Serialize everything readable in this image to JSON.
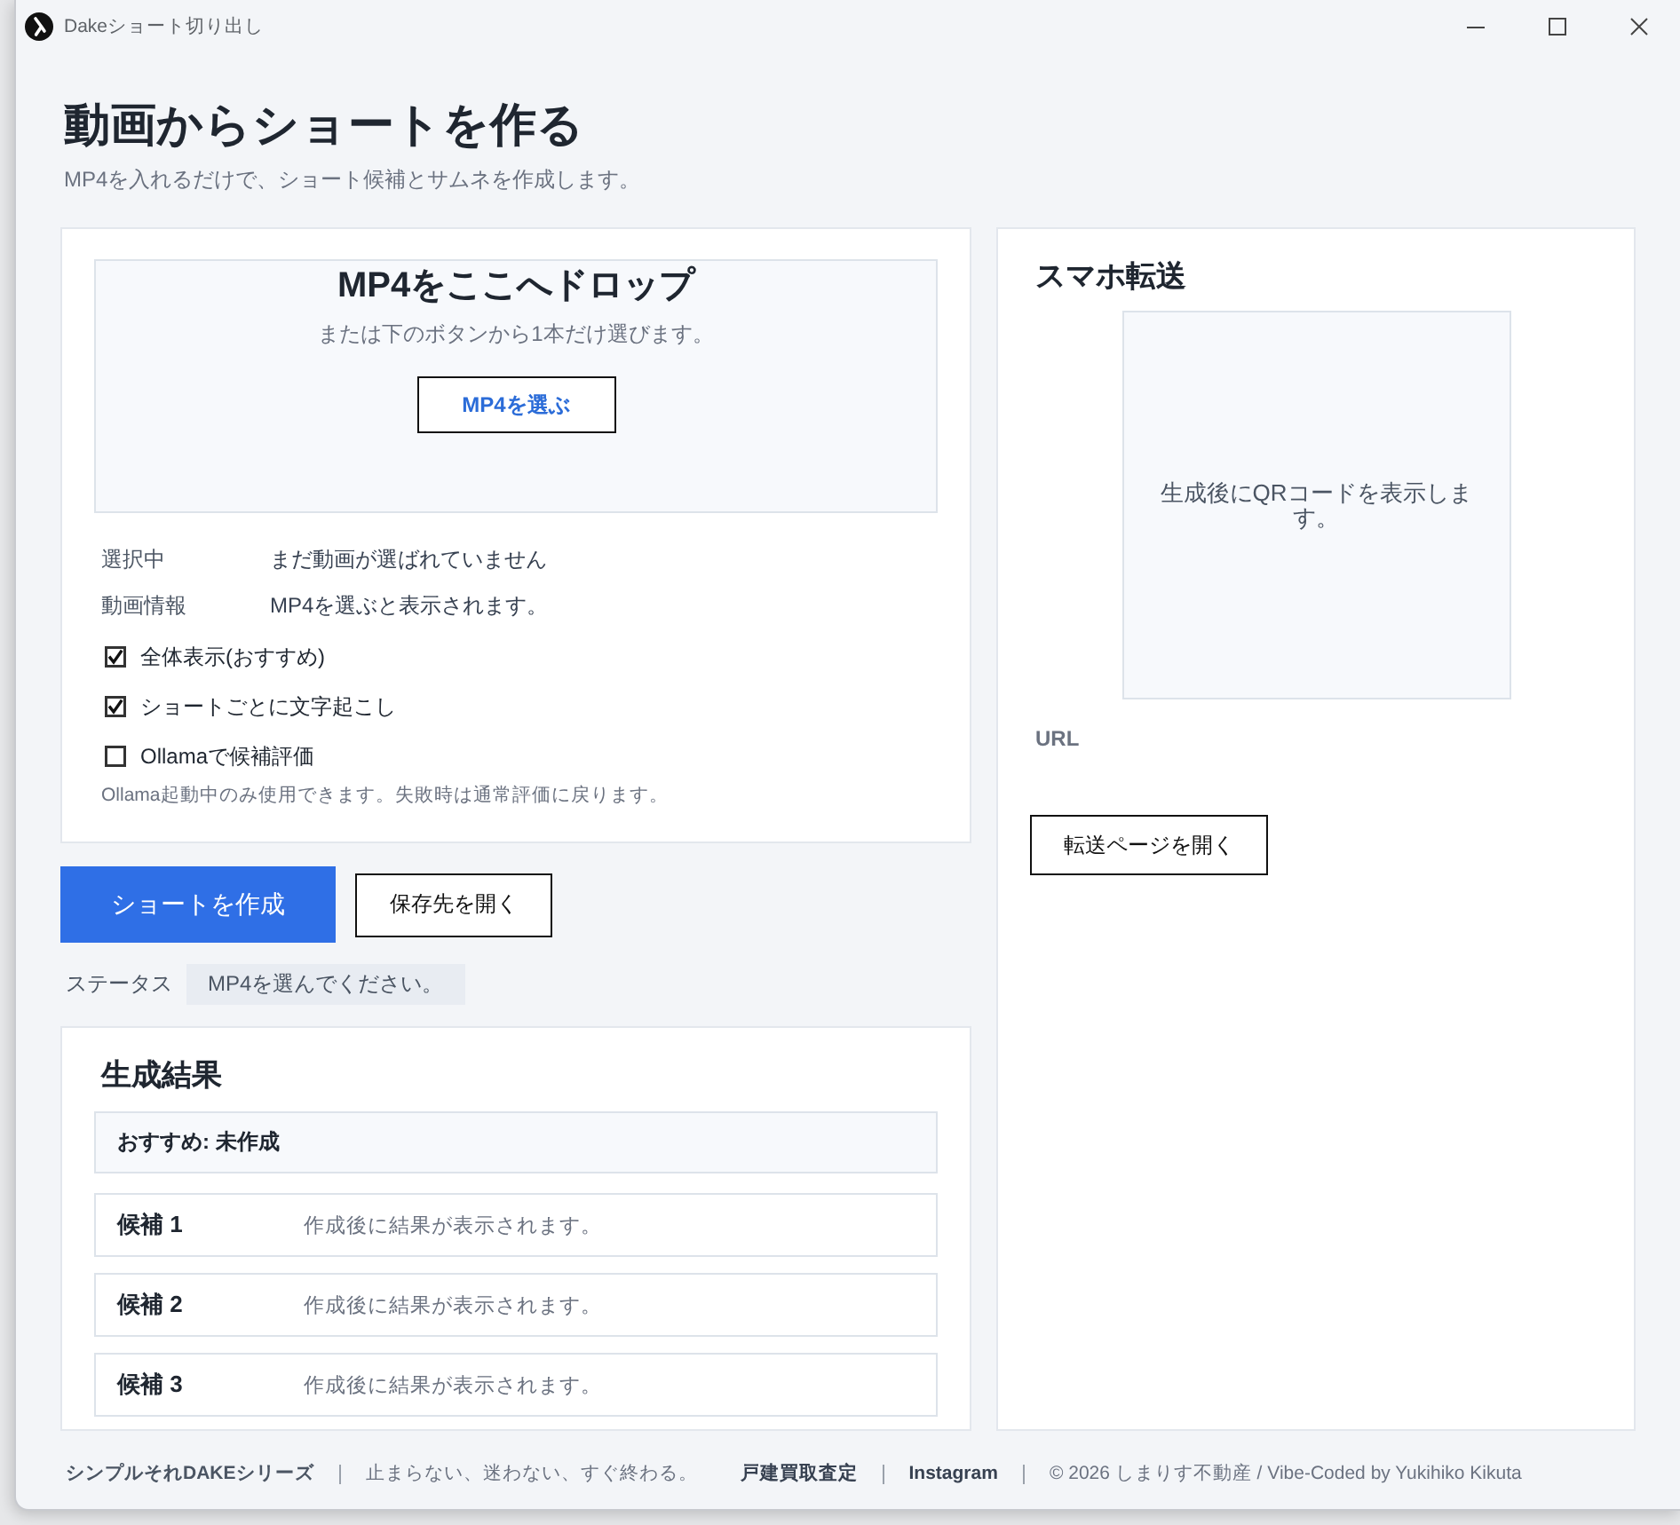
{
  "window": {
    "title": "Dakeショート切り出し"
  },
  "header": {
    "title": "動画からショートを作る",
    "subtitle": "MP4を入れるだけで、ショート候補とサムネを作成します。"
  },
  "input_card": {
    "drop_zone": {
      "title": "MP4をここへドロップ",
      "hint": "または下のボタンから1本だけ選びます。",
      "button": "MP4を選ぶ"
    },
    "info": [
      {
        "label": "選択中",
        "value": "まだ動画が選ばれていません"
      },
      {
        "label": "動画情報",
        "value": "MP4を選ぶと表示されます。"
      }
    ],
    "options": [
      {
        "label": "全体表示(おすすめ)",
        "checked": true
      },
      {
        "label": "ショートごとに文字起こし",
        "checked": true
      },
      {
        "label": "Ollamaで候補評価",
        "checked": false
      }
    ],
    "note": "Ollama起動中のみ使用できます。失敗時は通常評価に戻ります。"
  },
  "actions": [
    {
      "kind": "primary",
      "label": "ショートを作成"
    },
    {
      "kind": "secondary",
      "label": "保存先を開く"
    }
  ],
  "status": {
    "label": "ステータス",
    "value": "MP4を選んでください。"
  },
  "results": {
    "title": "生成結果",
    "recommended": "おすすめ: 未作成",
    "candidates": [
      {
        "label": "候補 1",
        "text": "作成後に結果が表示されます。"
      },
      {
        "label": "候補 2",
        "text": "作成後に結果が表示されます。"
      },
      {
        "label": "候補 3",
        "text": "作成後に結果が表示されます。"
      }
    ]
  },
  "transfer": {
    "title": "スマホ転送",
    "qr_placeholder": "生成後にQRコードを表示します。",
    "url_label": "URL",
    "button": "転送ページを開く"
  },
  "footer": {
    "groups": [
      [
        {
          "kind": "brand",
          "text": "シンプルそれDAKEシリーズ"
        }
      ],
      [
        {
          "kind": "text",
          "text": "止まらない、迷わない、すぐ終わる。"
        },
        {
          "kind": "link",
          "text": "戸建買取査定"
        }
      ],
      [
        {
          "kind": "link",
          "text": "Instagram"
        }
      ],
      [
        {
          "kind": "text",
          "text": "© 2026 しまりす不動産 / Vibe-Coded by Yukihiko Kikuta"
        }
      ]
    ]
  }
}
